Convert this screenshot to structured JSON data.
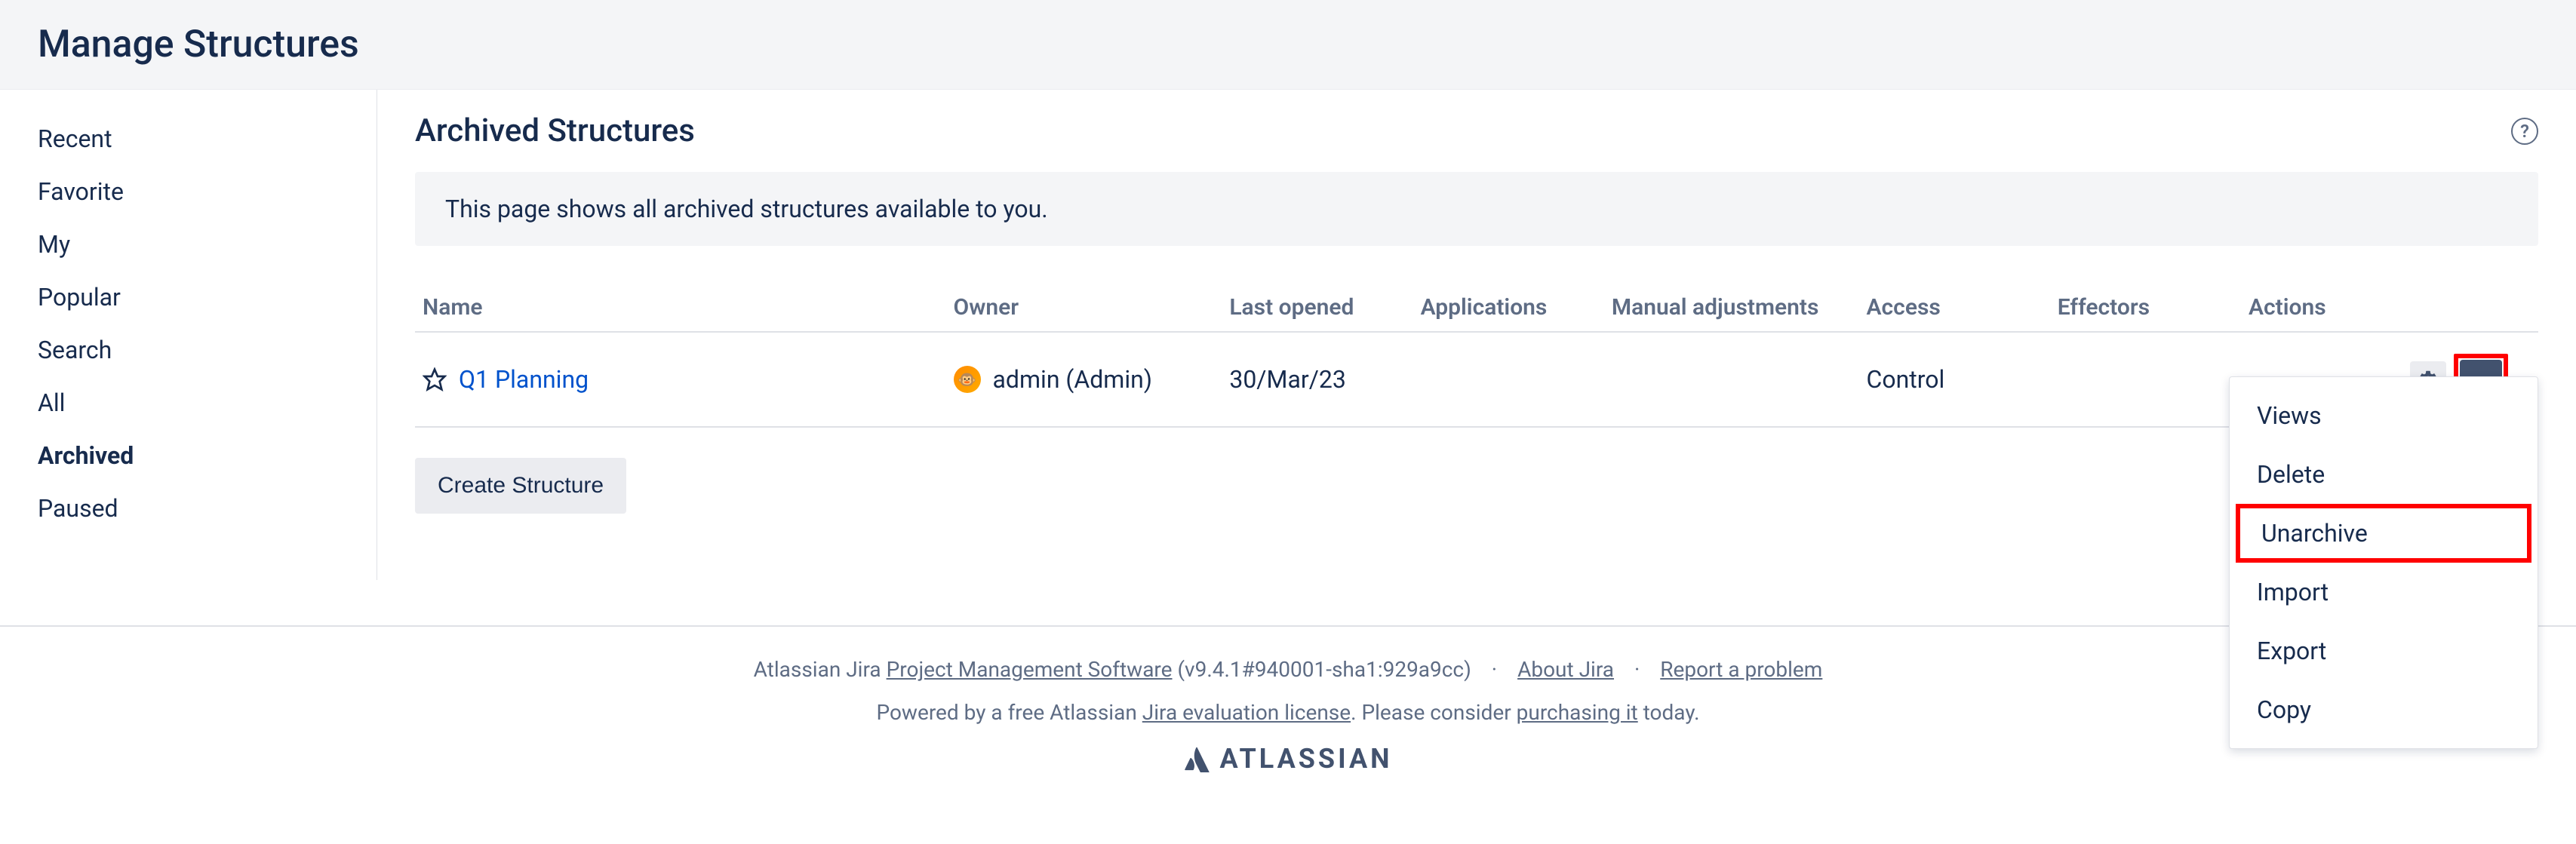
{
  "page_title": "Manage Structures",
  "sidebar": {
    "items": [
      {
        "label": "Recent",
        "active": false
      },
      {
        "label": "Favorite",
        "active": false
      },
      {
        "label": "My",
        "active": false
      },
      {
        "label": "Popular",
        "active": false
      },
      {
        "label": "Search",
        "active": false
      },
      {
        "label": "All",
        "active": false
      },
      {
        "label": "Archived",
        "active": true
      },
      {
        "label": "Paused",
        "active": false
      }
    ]
  },
  "content": {
    "heading": "Archived Structures",
    "info_text": "This page shows all archived structures available to you.",
    "columns": {
      "name": "Name",
      "owner": "Owner",
      "last_opened": "Last opened",
      "applications": "Applications",
      "manual_adjustments": "Manual adjustments",
      "access": "Access",
      "effectors": "Effectors",
      "actions": "Actions"
    },
    "rows": [
      {
        "name": "Q1 Planning",
        "owner": "admin (Admin)",
        "last_opened": "30/Mar/23",
        "applications": "",
        "manual_adjustments": "",
        "access": "Control",
        "effectors": ""
      }
    ],
    "create_label": "Create Structure"
  },
  "dropdown": {
    "items": [
      {
        "label": "Views"
      },
      {
        "label": "Delete"
      },
      {
        "label": "Unarchive"
      },
      {
        "label": "Import"
      },
      {
        "label": "Export"
      },
      {
        "label": "Copy"
      }
    ]
  },
  "footer": {
    "prefix": "Atlassian Jira ",
    "link1": "Project Management Software",
    "version": " (v9.4.1#940001-sha1:929a9cc)",
    "link_about": "About Jira",
    "link_report": "Report a problem",
    "line2_prefix": "Powered by a free Atlassian ",
    "line2_link": "Jira evaluation license",
    "line2_mid": ". Please consider ",
    "line2_link2": "purchasing it",
    "line2_suffix": " today.",
    "brand": "ATLASSIAN"
  }
}
